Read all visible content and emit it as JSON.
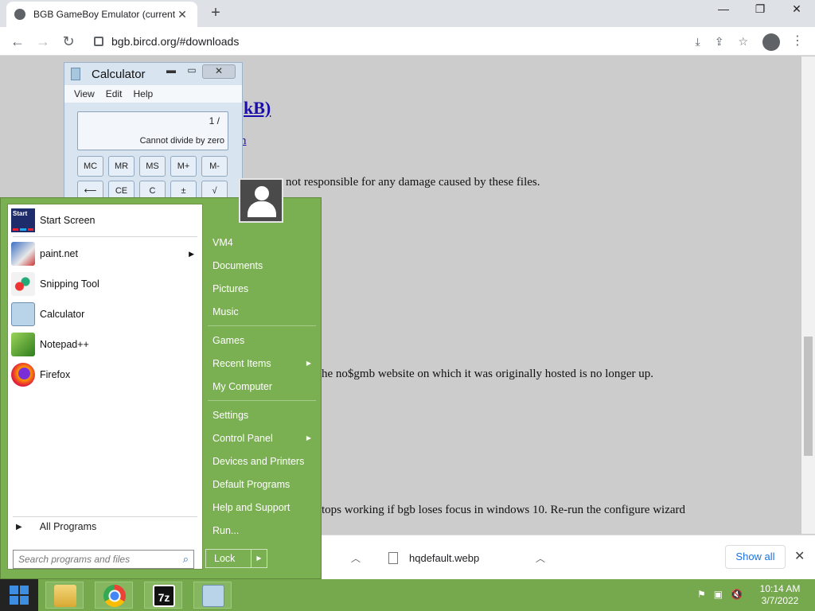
{
  "browser": {
    "tab_title": "BGB GameBoy Emulator (current",
    "tab_close": "✕",
    "new_tab": "+",
    "url": "bgb.bircd.org/#downloads",
    "win_min": "—",
    "win_max": "❐",
    "win_close": "✕"
  },
  "page": {
    "line1": "kB)",
    "line2": "n",
    "line3": "not responsible for any damage caused by these files.",
    "line4": "he no$gmb website on which it was originally hosted is no longer up.",
    "line5": "tops working if bgb loses focus in windows 10. Re-run the configure wizard"
  },
  "downloads": {
    "item_name": "hqdefault.webp",
    "show_all": "Show all"
  },
  "calculator": {
    "title": "Calculator",
    "menu": [
      "View",
      "Edit",
      "Help"
    ],
    "expression": "1 /",
    "result": "Cannot divide by zero",
    "row1": [
      "MC",
      "MR",
      "MS",
      "M+",
      "M-"
    ],
    "row2": [
      "⟵",
      "CE",
      "C",
      "±",
      "√"
    ]
  },
  "start_menu": {
    "pinned": [
      {
        "label": "Start Screen",
        "icon": "start-screen-icon"
      },
      {
        "label": "paint.net",
        "icon": "paintnet-icon",
        "submenu": true
      },
      {
        "label": "Snipping Tool",
        "icon": "scissors-icon"
      },
      {
        "label": "Calculator",
        "icon": "calculator-icon"
      },
      {
        "label": "Notepad++",
        "icon": "notepadpp-icon"
      },
      {
        "label": "Firefox",
        "icon": "firefox-icon"
      }
    ],
    "start_screen_icon_text": "Start",
    "all_programs": "All Programs",
    "search_placeholder": "Search programs and files",
    "right": {
      "user": "VM4",
      "documents": "Documents",
      "pictures": "Pictures",
      "music": "Music",
      "games": "Games",
      "recent_items": "Recent Items",
      "my_computer": "My Computer",
      "settings": "Settings",
      "control_panel": "Control Panel",
      "devices_printers": "Devices and Printers",
      "default_programs": "Default Programs",
      "help_support": "Help and Support",
      "run": "Run..."
    },
    "lock": "Lock"
  },
  "taskbar": {
    "time": "10:14 AM",
    "date": "3/7/2022",
    "sevenzip_label": "7z"
  },
  "colors": {
    "start_green": "#7ab052",
    "taskbar_green": "#76a84e",
    "link_blue": "#1a0dab"
  }
}
